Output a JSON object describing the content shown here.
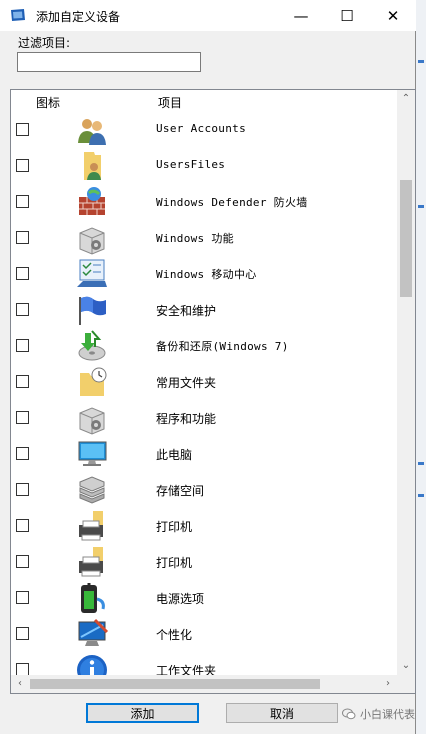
{
  "window": {
    "title": "添加自定义设备",
    "minimize_glyph": "—",
    "maximize_glyph": "☐",
    "close_glyph": "✕"
  },
  "filter": {
    "label": "过滤项目:",
    "value": "",
    "placeholder": ""
  },
  "list": {
    "columns": {
      "icon": "图标",
      "item": "项目"
    },
    "rows": [
      {
        "label": "User Accounts",
        "icon": "users-icon",
        "checked": false,
        "mono": true
      },
      {
        "label": "UsersFiles",
        "icon": "user-folder-icon",
        "checked": false,
        "mono": true
      },
      {
        "label": "Windows Defender 防火墙",
        "icon": "firewall-icon",
        "checked": false,
        "mono": true
      },
      {
        "label": "Windows 功能",
        "icon": "programs-box-icon",
        "checked": false,
        "mono": true
      },
      {
        "label": "Windows 移动中心",
        "icon": "mobility-center-icon",
        "checked": false,
        "mono": true
      },
      {
        "label": "安全和维护",
        "icon": "flag-icon",
        "checked": false,
        "mono": false
      },
      {
        "label": "备份和还原(Windows 7)",
        "icon": "backup-icon",
        "checked": false,
        "mono": true
      },
      {
        "label": "常用文件夹",
        "icon": "recent-folder-icon",
        "checked": false,
        "mono": false
      },
      {
        "label": "程序和功能",
        "icon": "programs-box-icon",
        "checked": false,
        "mono": false
      },
      {
        "label": "此电脑",
        "icon": "computer-icon",
        "checked": false,
        "mono": false
      },
      {
        "label": "存储空间",
        "icon": "storage-icon",
        "checked": false,
        "mono": false
      },
      {
        "label": "打印机",
        "icon": "printer-icon",
        "checked": false,
        "mono": false
      },
      {
        "label": "打印机",
        "icon": "printer-icon",
        "checked": false,
        "mono": false
      },
      {
        "label": "电源选项",
        "icon": "power-options-icon",
        "checked": false,
        "mono": false
      },
      {
        "label": "个性化",
        "icon": "personalization-icon",
        "checked": false,
        "mono": false
      },
      {
        "label": "工作文件夹",
        "icon": "info-icon",
        "checked": false,
        "mono": false
      }
    ],
    "scroll_up_glyph": "⌃",
    "scroll_down_glyph": "⌄",
    "scroll_left_glyph": "‹",
    "scroll_right_glyph": "›"
  },
  "buttons": {
    "add": "添加",
    "cancel": "取消"
  },
  "watermark": {
    "text": "小白课代表"
  },
  "colors": {
    "accent": "#0078d7",
    "window_bg": "#f0f0f0",
    "list_bg": "#ffffff"
  }
}
